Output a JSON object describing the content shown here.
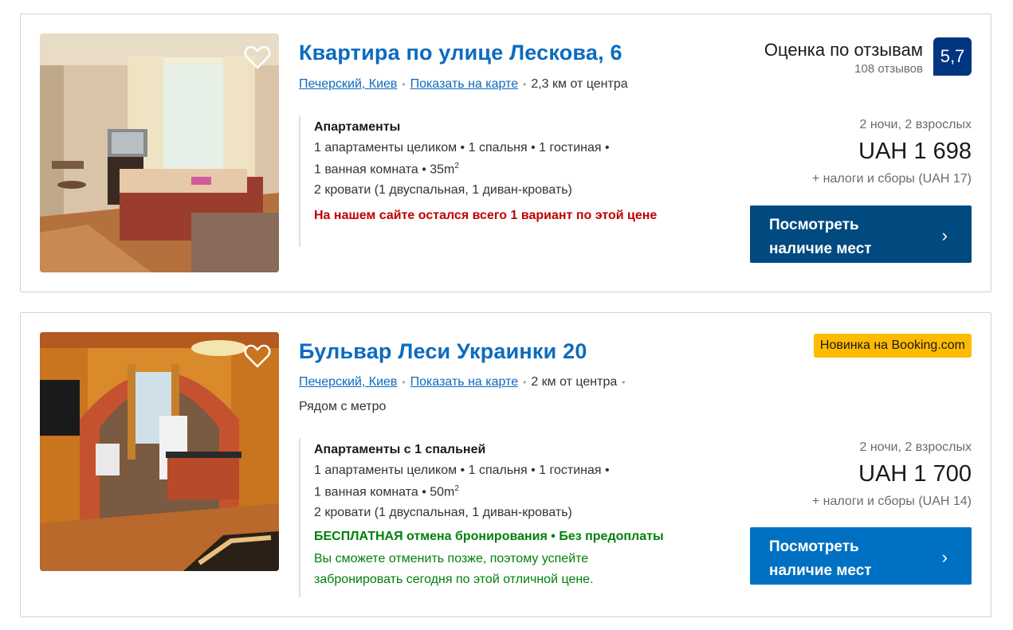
{
  "listings": [
    {
      "title": "Квартира по улице Лескова, 6",
      "district": "Печерский, Киев",
      "map_link": "Показать на карте",
      "distance": "2,3 км от центра",
      "review_label": "Оценка по отзывам",
      "review_count": "108 отзывов",
      "score": "5,7",
      "room_type": "Апартаменты",
      "details": [
        "1 апартаменты целиком • 1 спальня • 1 гостиная •",
        "1 ванная комната • 35m",
        "2 кровати (1 двуспальная, 1 диван-кровать)"
      ],
      "area_sup": "2",
      "alert": "На нашем сайте остался всего 1 вариант по этой цене",
      "stay": "2 ночи, 2 взрослых",
      "price": "UAH 1 698",
      "taxes": "+ налоги и сборы (UAH 17)",
      "cta": "Посмотреть наличие мест",
      "cta_line1": "Посмотреть",
      "cta_line2": "наличие мест"
    },
    {
      "title": "Бульвар Леси Украинки 20",
      "district": "Печерский, Киев",
      "map_link": "Показать на карте",
      "distance": "2 км от центра",
      "metro": "Рядом с метро",
      "badge": "Новинка на Booking.com",
      "room_type": "Апартаменты с 1 спальней",
      "details": [
        "1 апартаменты целиком • 1 спальня • 1 гостиная •",
        "1 ванная комната • 50m",
        "2 кровати (1 двуспальная, 1 диван-кровать)"
      ],
      "area_sup": "2",
      "free_cancel": "БЕСПЛАТНАЯ отмена бронирования • Без предоплаты",
      "free_cancel_note": "Вы сможете отменить позже, поэтому успейте забронировать сегодня по этой отличной цене.",
      "stay": "2 ночи, 2 взрослых",
      "price": "UAH 1 700",
      "taxes": "+ налоги и сборы (UAH 14)",
      "cta_line1": "Посмотреть",
      "cta_line2": "наличие мест"
    }
  ],
  "colors": {
    "link": "#0c6bbf",
    "score_bg": "#003580",
    "badge_bg": "#febb02",
    "alert": "#c00000",
    "free": "#008009",
    "cta_dark": "#004a80",
    "cta": "#0071c2"
  },
  "icons": {
    "favorite": "heart-icon",
    "chevron": "chevron-right-icon"
  }
}
